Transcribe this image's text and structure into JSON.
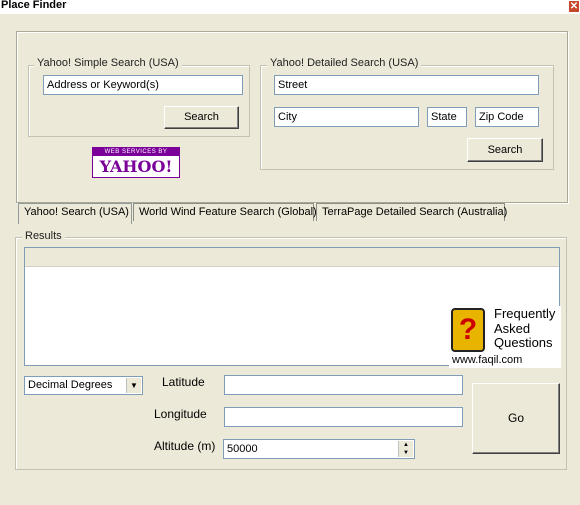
{
  "window": {
    "title": "Place Finder",
    "close_glyph": "✕"
  },
  "simple_search": {
    "legend": "Yahoo! Simple Search (USA)",
    "query_value": "Address or Keyword(s)",
    "search_label": "Search"
  },
  "yahoo_logo": {
    "top_text": "WEB SERVICES BY",
    "brand": "YAHOO!"
  },
  "detailed_search": {
    "legend": "Yahoo! Detailed Search (USA)",
    "street_value": "Street",
    "city_value": "City",
    "state_value": "State",
    "zip_value": "Zip Code",
    "search_label": "Search"
  },
  "tabs": [
    {
      "label": "Yahoo! Search (USA)",
      "active": true
    },
    {
      "label": "World Wind Feature Search (Global)",
      "active": false
    },
    {
      "label": "TerraPage Detailed Search (Australia)",
      "active": false
    }
  ],
  "results": {
    "legend": "Results"
  },
  "watermark": {
    "line1": "Frequently",
    "line2": "Asked",
    "line3": "Questions",
    "url": "www.faqil.com",
    "badge_glyph": "?"
  },
  "coords": {
    "format_selected": "Decimal Degrees",
    "latitude_label": "Latitude",
    "latitude_value": "",
    "longitude_label": "Longitude",
    "longitude_value": "",
    "altitude_label": "Altitude (m)",
    "altitude_value": "50000",
    "go_label": "Go"
  },
  "colors": {
    "window_bg": "#ece9d8",
    "field_border": "#7f9db9",
    "yahoo_purple": "#7b0099"
  }
}
